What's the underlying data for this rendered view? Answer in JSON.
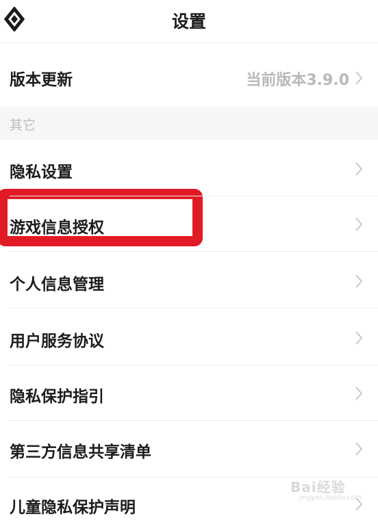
{
  "header": {
    "title": "设置",
    "back_icon": "back-diamond-icon"
  },
  "version_row": {
    "label": "版本更新",
    "value": "当前版本3.9.0"
  },
  "section": {
    "label": "其它"
  },
  "items": [
    {
      "label": "隐私设置"
    },
    {
      "label": "游戏信息授权"
    },
    {
      "label": "个人信息管理"
    },
    {
      "label": "用户服务协议"
    },
    {
      "label": "隐私保护指引"
    },
    {
      "label": "第三方信息共享清单"
    },
    {
      "label": "儿童隐私保护声明"
    }
  ],
  "watermark": {
    "text": "Bai经验",
    "sub": "jingyan.baidu.com"
  },
  "colors": {
    "highlight": "#e11b26",
    "chevron": "#c8c8c8",
    "section_bg": "#f6f6f6"
  }
}
